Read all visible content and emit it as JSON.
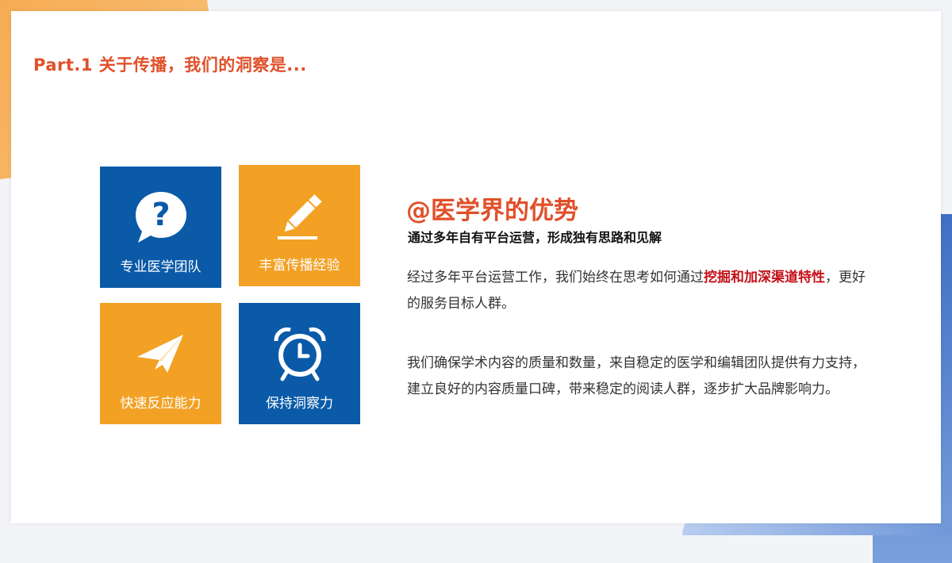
{
  "header": {
    "title": "Part.1 关于传播，我们的洞察是..."
  },
  "tiles": [
    {
      "label": "专业医学团队",
      "icon": "question-bubble-icon",
      "color": "#0a5aa8"
    },
    {
      "label": "丰富传播经验",
      "icon": "pencil-icon",
      "color": "#f2a124"
    },
    {
      "label": "快速反应能力",
      "icon": "paper-plane-icon",
      "color": "#f2a124"
    },
    {
      "label": "保持洞察力",
      "icon": "alarm-clock-icon",
      "color": "#0a5aa8"
    }
  ],
  "content": {
    "headline": "@医学界的优势",
    "subhead": "通过多年自有平台运营，形成独有思路和见解",
    "para1": {
      "before": "经过多年平台运营工作，我们始终在思考如何通过",
      "highlight": "挖掘和加深渠道特性",
      "after": "，更好的服务目标人群。"
    },
    "para2": "我们确保学术内容的质量和数量，来自稳定的医学和编辑团队提供有力支持，建立良好的内容质量口碑，带来稳定的阅读人群，逐步扩大品牌影响力。"
  },
  "colors": {
    "accent_orange": "#e0502a",
    "highlight_red": "#c41018",
    "tile_blue": "#0a5aa8",
    "tile_orange": "#f2a124"
  }
}
